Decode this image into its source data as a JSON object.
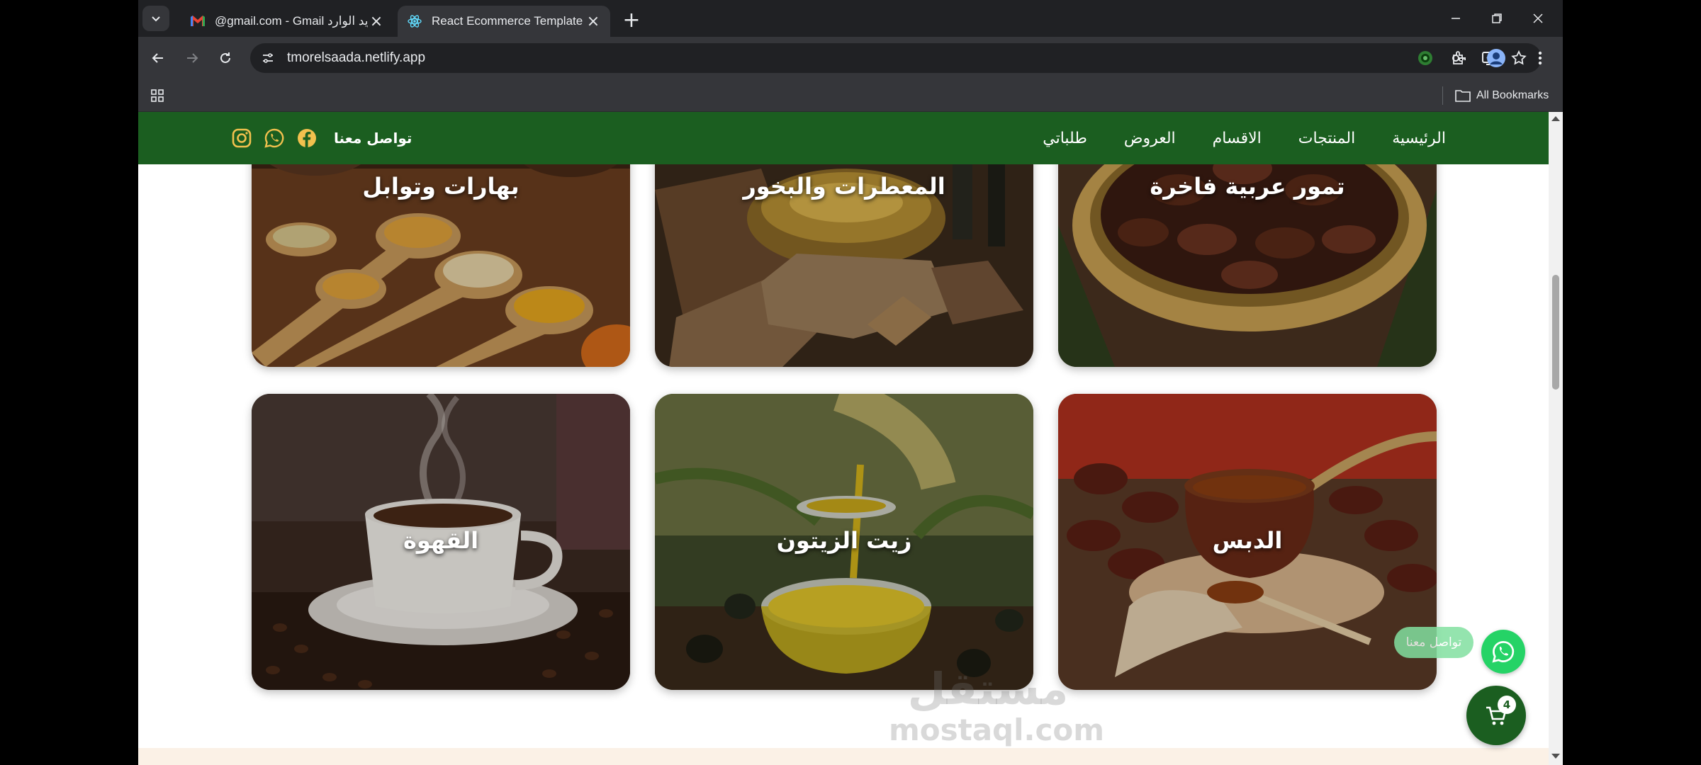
{
  "browser": {
    "tabs": [
      {
        "title": "@gmail.com - Gmail البريد الوارد",
        "icon": "gmail-icon",
        "active": false
      },
      {
        "title": "React Ecommerce Template",
        "icon": "react-icon",
        "active": true
      }
    ],
    "url": "tmorelsaada.netlify.app",
    "bookmarks_label": "All Bookmarks"
  },
  "site": {
    "nav": [
      "الرئيسية",
      "المنتجات",
      "الاقسام",
      "العروض",
      "طلباتي"
    ],
    "contact_label": "تواصل معنا",
    "social": [
      "facebook-icon",
      "whatsapp-icon",
      "instagram-icon"
    ],
    "brand_color": "#1b5e20"
  },
  "categories": [
    {
      "name": "تمور عربية فاخرة",
      "image": "dates-basket"
    },
    {
      "name": "المعطرات والبخور",
      "image": "incense-burner"
    },
    {
      "name": "بهارات وتوابل",
      "image": "spice-spoons"
    },
    {
      "name": "الدبس",
      "image": "date-syrup-bowl"
    },
    {
      "name": "زيت الزيتون",
      "image": "olive-oil-pour"
    },
    {
      "name": "القهوة",
      "image": "coffee-cup"
    }
  ],
  "watermark": {
    "arabic": "مستقل",
    "latin": "mostaql.com"
  },
  "floating": {
    "whatsapp_label": "تواصل معنا",
    "cart_count": "4"
  }
}
